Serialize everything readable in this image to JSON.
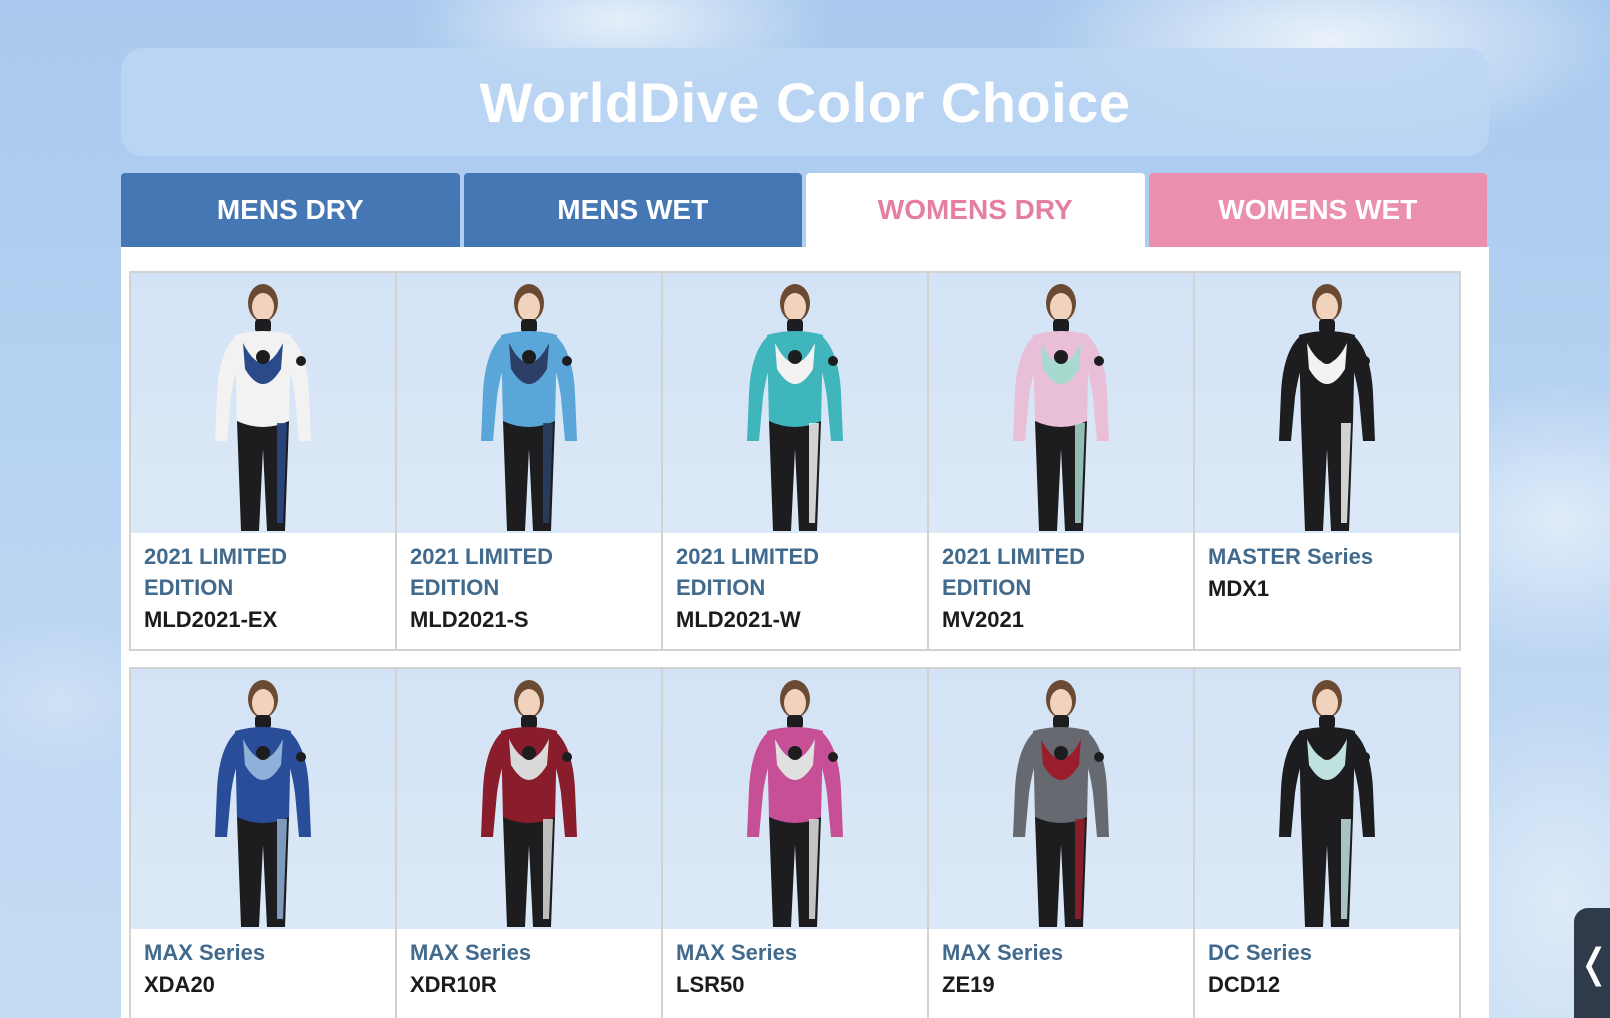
{
  "header": {
    "title": "WorldDive Color Choice"
  },
  "tabs": [
    {
      "label": "MENS DRY"
    },
    {
      "label": "MENS WET"
    },
    {
      "label": "WOMENS DRY",
      "active": true
    },
    {
      "label": "WOMENS WET"
    }
  ],
  "products": [
    {
      "series": "2021 LIMITED EDITION",
      "model": "MLD2021-EX",
      "colors": [
        "#f2f2f2",
        "#2a4a8a",
        "#1d1d1f"
      ]
    },
    {
      "series": "2021 LIMITED EDITION",
      "model": "MLD2021-S",
      "colors": [
        "#5aa6d9",
        "#2c3f66",
        "#1d1d1f"
      ]
    },
    {
      "series": "2021 LIMITED EDITION",
      "model": "MLD2021-W",
      "colors": [
        "#3fb6bb",
        "#f2f2f2",
        "#1d1d1f"
      ]
    },
    {
      "series": "2021 LIMITED EDITION",
      "model": "MV2021",
      "colors": [
        "#e8bfd6",
        "#a8d9cf",
        "#1d1d1f"
      ]
    },
    {
      "series": "MASTER Series",
      "model": "MDX1",
      "colors": [
        "#1d1d1f",
        "#f2f2f2",
        "#1d1d1f"
      ]
    },
    {
      "series": "MAX Series",
      "model": "XDA20",
      "colors": [
        "#2a4d9a",
        "#8fb0d8",
        "#1d1d1f"
      ]
    },
    {
      "series": "MAX Series",
      "model": "XDR10R",
      "colors": [
        "#8a1d2c",
        "#d9d9d9",
        "#1d1d1f"
      ]
    },
    {
      "series": "MAX Series",
      "model": "LSR50",
      "colors": [
        "#c64f95",
        "#e0e0e0",
        "#1d1d1f"
      ]
    },
    {
      "series": "MAX Series",
      "model": "ZE19",
      "colors": [
        "#666a70",
        "#9a1d2c",
        "#1d1d1f"
      ]
    },
    {
      "series": "DC Series",
      "model": "DCD12",
      "colors": [
        "#1d1d1f",
        "#bfe2e0",
        "#1d1d1f"
      ]
    }
  ],
  "side_handle": {
    "label": "❬",
    "icon": "chevron-left-icon"
  }
}
